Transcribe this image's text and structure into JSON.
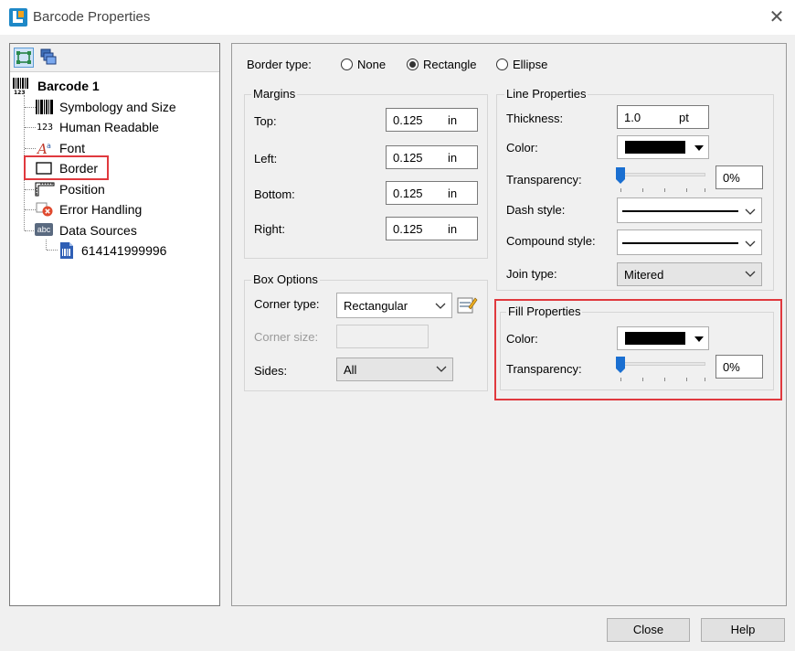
{
  "window": {
    "title": "Barcode Properties"
  },
  "tree": {
    "root": "Barcode 1",
    "items": [
      {
        "label": "Symbology and Size",
        "icon": "barcode-icon"
      },
      {
        "label": "Human Readable",
        "icon": "digits-icon",
        "icon_text": "123"
      },
      {
        "label": "Font",
        "icon": "font-icon"
      },
      {
        "label": "Border",
        "icon": "border-icon",
        "selected": true
      },
      {
        "label": "Position",
        "icon": "ruler-icon"
      },
      {
        "label": "Error Handling",
        "icon": "error-icon"
      },
      {
        "label": "Data Sources",
        "icon": "abc-icon",
        "icon_text": "abc"
      }
    ],
    "child": "614141999996"
  },
  "border_type": {
    "label": "Border type:",
    "options": [
      "None",
      "Rectangle",
      "Ellipse"
    ],
    "selected": "Rectangle"
  },
  "margins": {
    "title": "Margins",
    "top": {
      "label": "Top:",
      "value": "0.125",
      "unit": "in"
    },
    "left": {
      "label": "Left:",
      "value": "0.125",
      "unit": "in"
    },
    "bottom": {
      "label": "Bottom:",
      "value": "0.125",
      "unit": "in"
    },
    "right": {
      "label": "Right:",
      "value": "0.125",
      "unit": "in"
    }
  },
  "box_options": {
    "title": "Box Options",
    "corner_type": {
      "label": "Corner type:",
      "value": "Rectangular"
    },
    "corner_size": {
      "label": "Corner size:"
    },
    "sides": {
      "label": "Sides:",
      "value": "All"
    }
  },
  "line_properties": {
    "title": "Line Properties",
    "thickness": {
      "label": "Thickness:",
      "value": "1.0",
      "unit": "pt"
    },
    "color": {
      "label": "Color:",
      "value": "#000000"
    },
    "transparency": {
      "label": "Transparency:",
      "value": "0%",
      "level": 0
    },
    "dash_style": {
      "label": "Dash style:"
    },
    "compound_style": {
      "label": "Compound style:"
    },
    "join_type": {
      "label": "Join type:",
      "value": "Mitered"
    }
  },
  "fill_properties": {
    "title": "Fill Properties",
    "color": {
      "label": "Color:",
      "value": "#000000"
    },
    "transparency": {
      "label": "Transparency:",
      "value": "0%",
      "level": 0
    }
  },
  "buttons": {
    "close": "Close",
    "help": "Help"
  },
  "colors": {
    "highlight": "#e0393e",
    "slider_thumb": "#1a6fd1"
  }
}
